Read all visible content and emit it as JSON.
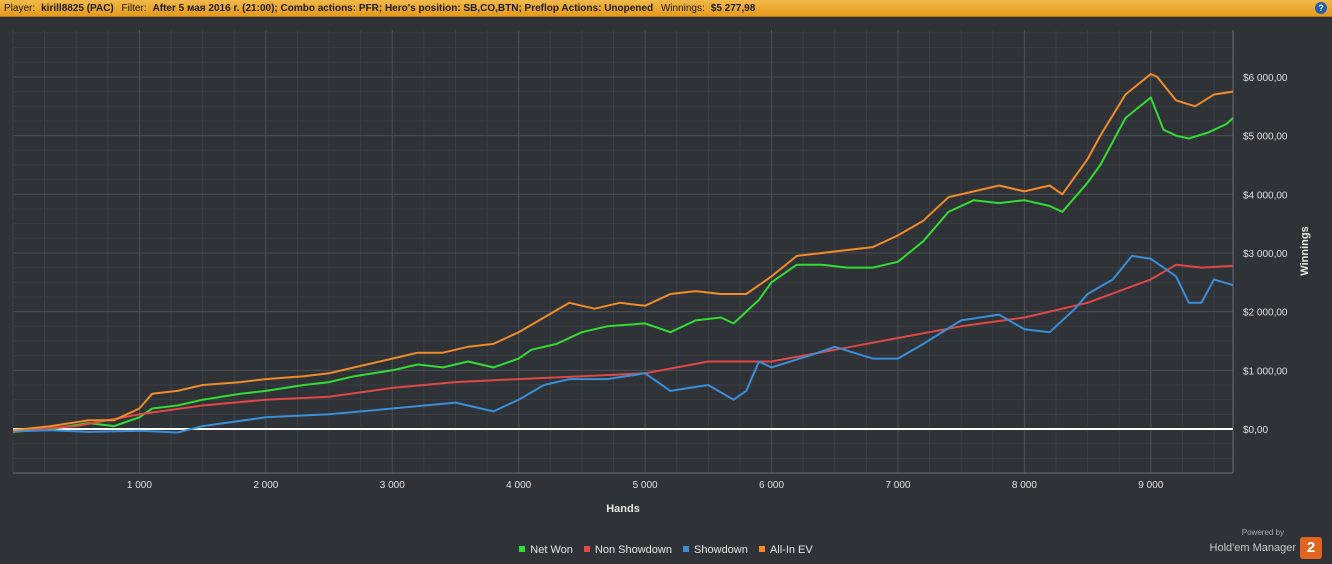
{
  "header": {
    "player_label": "Player:",
    "player": "kirill8825 (PAC)",
    "filter_label": "Filter:",
    "filter": "After 5 мая 2016 г. (21:00); Combo actions: PFR; Hero's position: SB,CO,BTN; Preflop Actions: Unopened",
    "winnings_label": "Winnings:",
    "winnings": "$5 277,98",
    "help": "?"
  },
  "brand": {
    "powered": "Powered by",
    "name": "Hold'em Manager",
    "logo": "2"
  },
  "colors": {
    "background": "#2f3237",
    "header": "#f0a830",
    "net_won": "#33dd33",
    "non_showdown": "#e04848",
    "showdown": "#3a8fd8",
    "all_in_ev": "#f08c2a",
    "zero_line": "#ffffff"
  },
  "chart_data": {
    "type": "line",
    "xlabel": "Hands",
    "ylabel": "Winnings",
    "xlim": [
      0,
      9650
    ],
    "ylim": [
      -750,
      6800
    ],
    "x_ticks": [
      1000,
      2000,
      3000,
      4000,
      5000,
      6000,
      7000,
      8000,
      9000
    ],
    "x_tick_labels": [
      "1 000",
      "2 000",
      "3 000",
      "4 000",
      "5 000",
      "6 000",
      "7 000",
      "8 000",
      "9 000"
    ],
    "y_ticks": [
      0,
      1000,
      2000,
      3000,
      4000,
      5000,
      6000
    ],
    "y_tick_labels": [
      "$0,00",
      "$1 000,00",
      "$2 000,00",
      "$3 000,00",
      "$4 000,00",
      "$5 000,00",
      "$6 000,00"
    ],
    "grid": true,
    "legend_position": "bottom-center",
    "series": [
      {
        "name": "Net Won",
        "color": "#33dd33",
        "x": [
          0,
          300,
          600,
          800,
          1000,
          1100,
          1300,
          1500,
          1800,
          2000,
          2300,
          2500,
          2700,
          3000,
          3200,
          3400,
          3600,
          3800,
          4000,
          4100,
          4300,
          4500,
          4700,
          5000,
          5200,
          5400,
          5600,
          5700,
          5800,
          5900,
          6000,
          6200,
          6400,
          6600,
          6800,
          7000,
          7200,
          7400,
          7600,
          7800,
          8000,
          8200,
          8300,
          8500,
          8600,
          8800,
          9000,
          9100,
          9200,
          9300,
          9450,
          9600,
          9650
        ],
        "y": [
          -50,
          0,
          100,
          50,
          200,
          350,
          400,
          500,
          600,
          650,
          750,
          800,
          900,
          1000,
          1100,
          1050,
          1150,
          1050,
          1200,
          1350,
          1450,
          1650,
          1750,
          1800,
          1650,
          1850,
          1900,
          1800,
          2000,
          2200,
          2500,
          2800,
          2800,
          2750,
          2750,
          2850,
          3200,
          3700,
          3900,
          3850,
          3900,
          3800,
          3700,
          4200,
          4500,
          5300,
          5650,
          5100,
          5000,
          4950,
          5050,
          5200,
          5300
        ]
      },
      {
        "name": "Non Showdown",
        "color": "#e04848",
        "x": [
          0,
          500,
          1000,
          1500,
          2000,
          2500,
          3000,
          3500,
          4000,
          4500,
          5000,
          5500,
          6000,
          6500,
          7000,
          7500,
          8000,
          8500,
          9000,
          9200,
          9400,
          9650
        ],
        "y": [
          -30,
          50,
          250,
          400,
          500,
          550,
          700,
          800,
          850,
          900,
          950,
          1150,
          1150,
          1350,
          1550,
          1750,
          1900,
          2150,
          2550,
          2800,
          2750,
          2780
        ]
      },
      {
        "name": "Showdown",
        "color": "#3a8fd8",
        "x": [
          0,
          300,
          600,
          1000,
          1300,
          1500,
          2000,
          2500,
          3000,
          3500,
          3800,
          4000,
          4200,
          4400,
          4700,
          5000,
          5200,
          5500,
          5700,
          5800,
          5900,
          6000,
          6300,
          6500,
          6800,
          7000,
          7200,
          7500,
          7800,
          8000,
          8200,
          8400,
          8500,
          8700,
          8850,
          9000,
          9100,
          9200,
          9300,
          9400,
          9500,
          9650
        ],
        "y": [
          -40,
          -20,
          -50,
          -30,
          -60,
          50,
          200,
          250,
          350,
          450,
          300,
          500,
          750,
          850,
          850,
          950,
          650,
          750,
          500,
          650,
          1150,
          1050,
          1250,
          1400,
          1200,
          1200,
          1450,
          1850,
          1950,
          1700,
          1650,
          2050,
          2300,
          2550,
          2950,
          2900,
          2750,
          2600,
          2150,
          2150,
          2550,
          2450
        ]
      },
      {
        "name": "All-In EV",
        "color": "#f08c2a",
        "x": [
          0,
          300,
          600,
          800,
          1000,
          1100,
          1300,
          1500,
          1800,
          2000,
          2300,
          2500,
          2700,
          3000,
          3200,
          3400,
          3600,
          3800,
          4000,
          4200,
          4400,
          4600,
          4800,
          5000,
          5200,
          5400,
          5600,
          5800,
          5900,
          6000,
          6200,
          6400,
          6600,
          6800,
          7000,
          7200,
          7400,
          7600,
          7800,
          8000,
          8200,
          8300,
          8500,
          8600,
          8800,
          9000,
          9050,
          9200,
          9350,
          9500,
          9650
        ],
        "y": [
          -20,
          50,
          150,
          150,
          350,
          600,
          650,
          750,
          800,
          850,
          900,
          950,
          1050,
          1200,
          1300,
          1300,
          1400,
          1450,
          1650,
          1900,
          2150,
          2050,
          2150,
          2100,
          2300,
          2350,
          2300,
          2300,
          2450,
          2600,
          2950,
          3000,
          3050,
          3100,
          3300,
          3550,
          3950,
          4050,
          4150,
          4050,
          4150,
          4000,
          4600,
          5000,
          5700,
          6050,
          6000,
          5600,
          5500,
          5700,
          5750
        ]
      }
    ]
  }
}
